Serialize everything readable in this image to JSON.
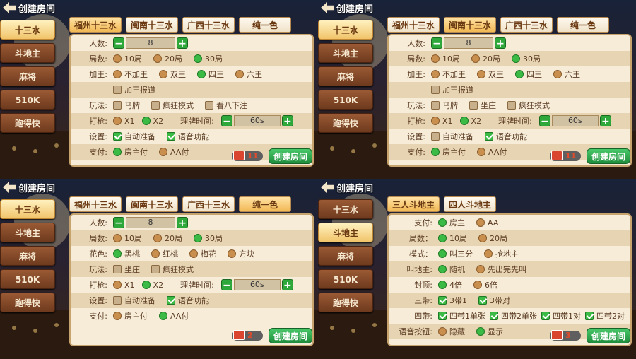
{
  "title": "创建房间",
  "modes": [
    "十三水",
    "斗地主",
    "麻将",
    "510K",
    "跑得快"
  ],
  "panels": [
    {
      "active_mode": 0,
      "tabs": [
        {
          "label": "福州十三水",
          "active": true
        },
        {
          "label": "闽南十三水"
        },
        {
          "label": "广西十三水"
        },
        {
          "label": "纯一色"
        }
      ],
      "players": {
        "label": "人数:",
        "value": "8"
      },
      "rounds": {
        "label": "局数:",
        "options": [
          {
            "t": "10局"
          },
          {
            "t": "20局"
          },
          {
            "t": "30局",
            "on": true
          }
        ]
      },
      "bonus": {
        "label": "加王:",
        "options": [
          {
            "t": "不加王"
          },
          {
            "t": "双王"
          },
          {
            "t": "四王",
            "on": true
          },
          {
            "t": "六王"
          }
        ],
        "extra": "加王报道"
      },
      "play": {
        "label": "玩法:",
        "options": [
          {
            "t": "马牌"
          },
          {
            "t": "疯狂模式"
          },
          {
            "t": "看八下注"
          }
        ]
      },
      "shoot": {
        "label": "打枪:",
        "options": [
          {
            "t": "X1"
          },
          {
            "t": "X2",
            "on": true
          }
        ],
        "time_label": "理牌时间:",
        "time_value": "60s"
      },
      "settings": {
        "label": "设置:",
        "options": [
          {
            "t": "自动准备",
            "on": true
          },
          {
            "t": "语音功能",
            "on": true
          }
        ]
      },
      "pay": {
        "label": "支付:",
        "options": [
          {
            "t": "房主付",
            "on": true
          },
          {
            "t": "AA付"
          }
        ]
      },
      "cost": "11",
      "create": "创建房间"
    },
    {
      "active_mode": 0,
      "tabs": [
        {
          "label": "福州十三水"
        },
        {
          "label": "闽南十三水",
          "active": true
        },
        {
          "label": "广西十三水"
        },
        {
          "label": "纯一色"
        }
      ],
      "players": {
        "label": "人数:",
        "value": "8"
      },
      "rounds": {
        "label": "局数:",
        "options": [
          {
            "t": "10局"
          },
          {
            "t": "20局"
          },
          {
            "t": "30局",
            "on": true
          }
        ]
      },
      "bonus": {
        "label": "加王:",
        "options": [
          {
            "t": "不加王"
          },
          {
            "t": "双王"
          },
          {
            "t": "四王",
            "on": true
          },
          {
            "t": "六王"
          }
        ],
        "extra": "加王报道"
      },
      "play": {
        "label": "玩法:",
        "options": [
          {
            "t": "马牌"
          },
          {
            "t": "坐庄"
          },
          {
            "t": "疯狂模式"
          }
        ]
      },
      "shoot": {
        "label": "打枪:",
        "options": [
          {
            "t": "X1"
          },
          {
            "t": "X2",
            "on": true
          }
        ],
        "time_label": "理牌时间:",
        "time_value": "60s"
      },
      "settings": {
        "label": "设置:",
        "options": [
          {
            "t": "自动准备"
          },
          {
            "t": "语音功能",
            "on": true
          }
        ]
      },
      "pay": {
        "label": "支付:",
        "options": [
          {
            "t": "房主付",
            "on": true
          },
          {
            "t": "AA付"
          }
        ]
      },
      "cost": "11",
      "create": "创建房间"
    },
    {
      "active_mode": 0,
      "tabs": [
        {
          "label": "福州十三水"
        },
        {
          "label": "闽南十三水"
        },
        {
          "label": "广西十三水"
        },
        {
          "label": "纯一色",
          "active": true
        }
      ],
      "players": {
        "label": "人数:",
        "value": "8"
      },
      "rounds": {
        "label": "局数:",
        "options": [
          {
            "t": "10局"
          },
          {
            "t": "20局"
          },
          {
            "t": "30局",
            "on": true
          }
        ]
      },
      "suit": {
        "label": "花色:",
        "options": [
          {
            "t": "黑桃",
            "on": true
          },
          {
            "t": "红桃"
          },
          {
            "t": "梅花"
          },
          {
            "t": "方块"
          }
        ]
      },
      "play": {
        "label": "玩法:",
        "options": [
          {
            "t": "坐庄"
          },
          {
            "t": "疯狂模式"
          }
        ]
      },
      "shoot": {
        "label": "打枪:",
        "options": [
          {
            "t": "X1"
          },
          {
            "t": "X2",
            "on": true
          }
        ],
        "time_label": "理牌时间:",
        "time_value": "60s"
      },
      "settings": {
        "label": "设置:",
        "options": [
          {
            "t": "自动准备"
          },
          {
            "t": "语音功能",
            "on": true
          }
        ]
      },
      "pay": {
        "label": "支付:",
        "options": [
          {
            "t": "房主付"
          },
          {
            "t": "AA付",
            "on": true
          }
        ]
      },
      "cost": "2",
      "create": "创建房间"
    },
    {
      "active_mode": 1,
      "tabs": [
        {
          "label": "三人斗地主",
          "active": true
        },
        {
          "label": "四人斗地主"
        }
      ],
      "rows": [
        {
          "label": "支付:",
          "type": "radio",
          "options": [
            {
              "t": "房主",
              "on": true
            },
            {
              "t": "AA"
            }
          ]
        },
        {
          "label": "局数：",
          "type": "radio",
          "options": [
            {
              "t": "10局",
              "on": true
            },
            {
              "t": "20局"
            }
          ]
        },
        {
          "label": "模式：",
          "type": "radio",
          "options": [
            {
              "t": "叫三分",
              "on": true
            },
            {
              "t": "抢地主"
            }
          ]
        },
        {
          "label": "叫地主:",
          "type": "radio",
          "options": [
            {
              "t": "随机",
              "on": true
            },
            {
              "t": "先出完先叫"
            }
          ]
        },
        {
          "label": "封顶:",
          "type": "radio",
          "options": [
            {
              "t": "4倍",
              "on": true
            },
            {
              "t": "6倍"
            }
          ]
        },
        {
          "label": "三带:",
          "type": "check",
          "options": [
            {
              "t": "3带1",
              "on": true
            },
            {
              "t": "3带对",
              "on": true
            }
          ]
        },
        {
          "label": "四带:",
          "type": "check",
          "options": [
            {
              "t": "四带1单张",
              "on": true
            },
            {
              "t": "四带2单张",
              "on": true
            },
            {
              "t": "四带1对",
              "on": true
            },
            {
              "t": "四带2对",
              "on": true
            }
          ]
        },
        {
          "label": "语音按钮:",
          "type": "radio",
          "options": [
            {
              "t": "隐藏"
            },
            {
              "t": "显示",
              "on": true
            }
          ]
        }
      ],
      "cost": "3",
      "create": "创建房间"
    }
  ]
}
